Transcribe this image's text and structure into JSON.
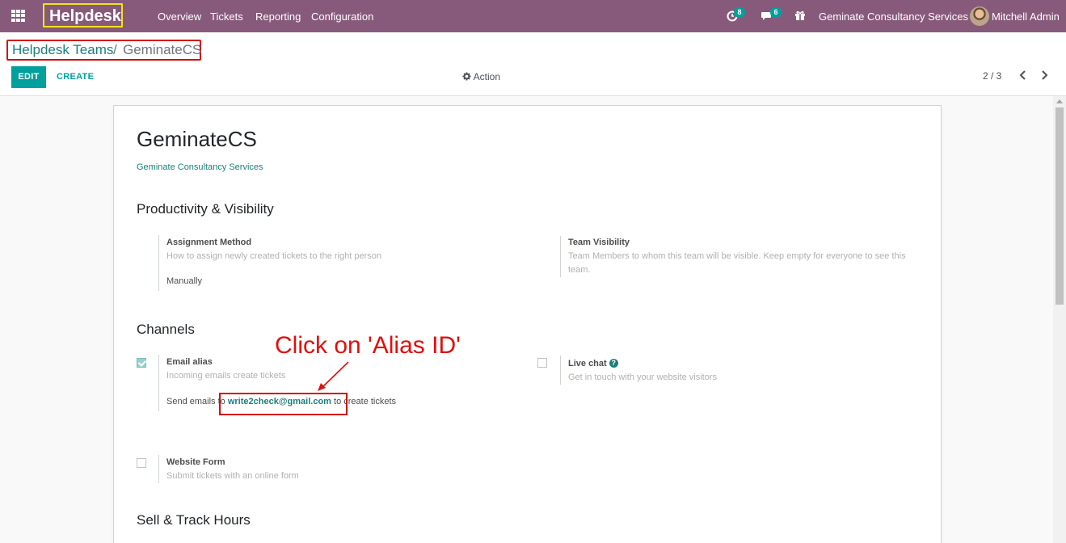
{
  "navbar": {
    "app_name": "Helpdesk",
    "menu": [
      "Overview",
      "Tickets",
      "Reporting",
      "Configuration"
    ],
    "activity_count": "8",
    "messages_count": "6",
    "company": "Geminate Consultancy Services",
    "user": "Mitchell Admin",
    "icons": [
      "apps-icon",
      "clock-icon",
      "chat-icon",
      "gift-icon"
    ]
  },
  "breadcrumb": {
    "parent": "Helpdesk Teams",
    "separator": "/",
    "current": "GeminateCS"
  },
  "control": {
    "edit": "EDIT",
    "create": "CREATE",
    "action": "Action",
    "pager": "2 / 3"
  },
  "form": {
    "title": "GeminateCS",
    "company": "Geminate Consultancy Services",
    "productivity": {
      "heading": "Productivity & Visibility",
      "assignment_label": "Assignment Method",
      "assignment_help": "How to assign newly created tickets to the right person",
      "assignment_value": "Manually",
      "visibility_label": "Team Visibility",
      "visibility_help": "Team Members to whom this team will be visible. Keep empty for everyone to see this team."
    },
    "channels": {
      "heading": "Channels",
      "email_label": "Email alias",
      "email_help": "Incoming emails create tickets",
      "email_checked": true,
      "send_prefix": "Send emails to",
      "email_address": "write2check@gmail.com",
      "send_suffix": "to create tickets",
      "livechat_label": "Live chat",
      "livechat_help": "Get in touch with your website visitors",
      "livechat_checked": false,
      "website_label": "Website Form",
      "website_help": "Submit tickets with an online form",
      "website_checked": false
    },
    "sell_heading": "Sell & Track Hours"
  },
  "annotation": {
    "text": "Click on 'Alias ID'",
    "color": "#e10e0e"
  },
  "colors": {
    "navbar": "#875a7b",
    "primary": "#00a09d",
    "link": "#1b7f7b",
    "highlight_brand": "#f2e31a",
    "highlight_red": "#d40d0d"
  }
}
